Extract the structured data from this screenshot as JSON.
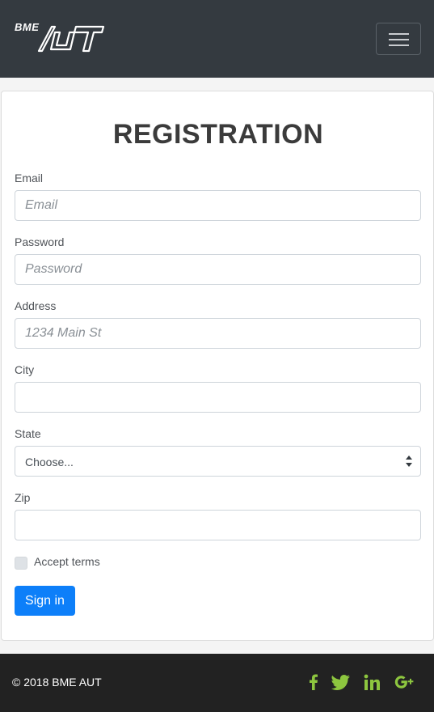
{
  "navbar": {
    "brand_prefix": "BME",
    "brand_logo": "AUT",
    "menu_icon": "hamburger-icon"
  },
  "form": {
    "title": "REGISTRATION",
    "email": {
      "label": "Email",
      "placeholder": "Email",
      "value": ""
    },
    "password": {
      "label": "Password",
      "placeholder": "Password",
      "value": ""
    },
    "address": {
      "label": "Address",
      "placeholder": "1234 Main St",
      "value": ""
    },
    "city": {
      "label": "City",
      "placeholder": "",
      "value": ""
    },
    "state": {
      "label": "State",
      "selected": "Choose..."
    },
    "zip": {
      "label": "Zip",
      "placeholder": "",
      "value": ""
    },
    "terms_label": "Accept terms",
    "terms_checked": false,
    "submit_label": "Sign in"
  },
  "footer": {
    "copyright": "© 2018 BME AUT",
    "social": [
      "facebook-icon",
      "twitter-icon",
      "linkedin-icon",
      "google-plus-icon"
    ],
    "social_color": "#8dc63f"
  },
  "colors": {
    "navbar_bg": "#343a40",
    "footer_bg": "#222222",
    "primary": "#0d7ff9"
  }
}
